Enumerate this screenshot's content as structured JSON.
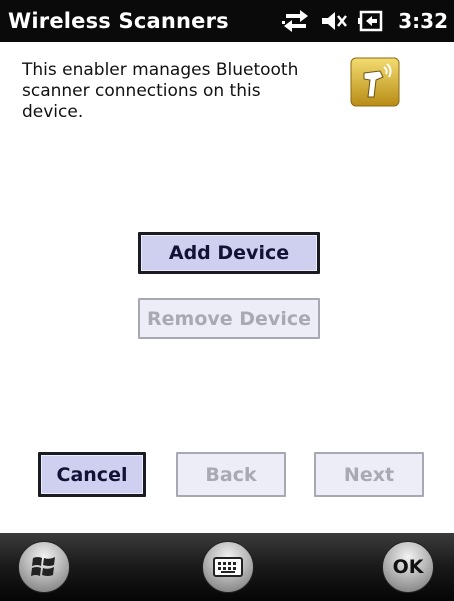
{
  "titlebar": {
    "title": "Wireless Scanners",
    "clock": "3:32",
    "icons": [
      "connectivity-icon",
      "volume-muted-icon",
      "battery-icon"
    ]
  },
  "content": {
    "description": "This enabler manages Bluetooth scanner connections on this device.",
    "app_icon": "bluetooth-scanner-icon",
    "add_device_label": "Add Device",
    "remove_device_label": "Remove Device",
    "cancel_label": "Cancel",
    "back_label": "Back",
    "next_label": "Next"
  },
  "softbar": {
    "icons": [
      "windows-start-icon",
      "keyboard-icon"
    ],
    "ok_label": "OK"
  },
  "colors": {
    "button_fill": "#cfcff0",
    "button_disabled_fill": "#ededf8",
    "title_bar": "#0a0a0a",
    "app_icon_gold": "#c9a227"
  }
}
